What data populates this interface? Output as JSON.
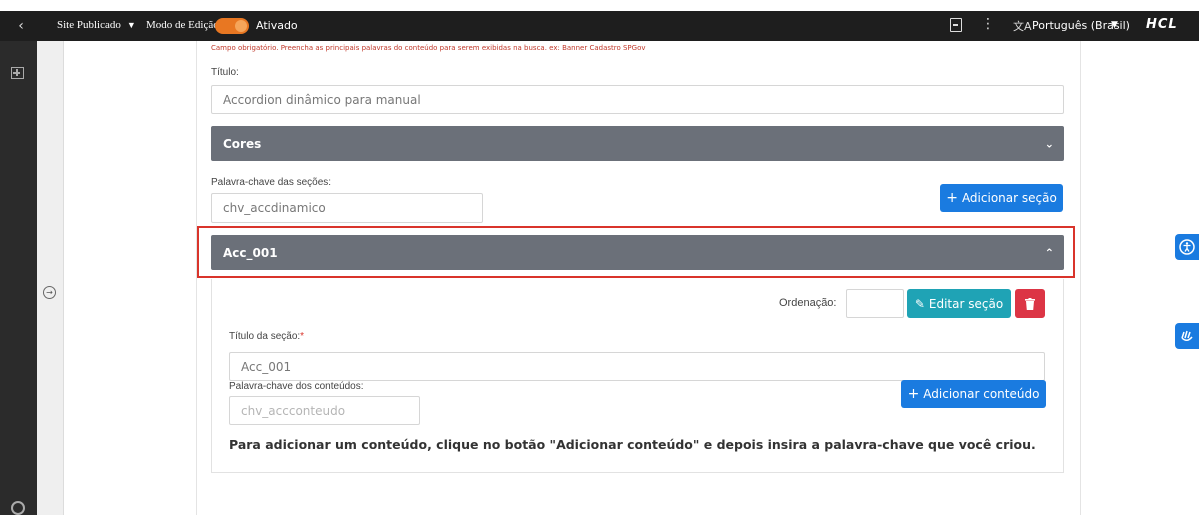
{
  "topbar": {
    "back_glyph": "‹",
    "site_status": "Site Publicado",
    "edit_mode_label": "Modo de Edição:",
    "edit_mode_state": "Ativado",
    "language": "Português (Brasil)",
    "brand": "HCL",
    "icons": [
      "chevron-left-icon",
      "page-icon",
      "kebab-icon",
      "translate-icon"
    ]
  },
  "form": {
    "required_hint": "Campo obrigatório. Preencha as principais palavras do conteúdo para serem exibidas na busca. ex: Banner Cadastro SPGov",
    "title_label": "Título:",
    "title_value": "Accordion dinâmico para manual",
    "colors_section": "Cores",
    "sections_keyword_label": "Palavra-chave das seções:",
    "sections_keyword_value": "chv_accdinamico",
    "add_section_button": "Adicionar seção"
  },
  "section": {
    "header": "Acc_001",
    "order_label": "Ordenação:",
    "order_value": "",
    "edit_button": "Editar seção",
    "section_title_label": "Título da seção:",
    "required_marker": "*",
    "section_title_value": "Acc_001",
    "content_keyword_label": "Palavra-chave dos conteúdos:",
    "content_keyword_placeholder": "chv_accconteudo",
    "add_content_button": "Adicionar conteúdo",
    "instructions": "Para adicionar um conteúdo, clique no botão \"Adicionar conteúdo\" e depois insira a palavra-chave que você criou."
  },
  "colors": {
    "accent_blue": "#1a7be0",
    "teal": "#1fa3b5",
    "danger": "#dc3545",
    "toggle_orange": "#e87722",
    "accordion_gray": "#6b7079",
    "highlight_red": "#d9342b"
  }
}
